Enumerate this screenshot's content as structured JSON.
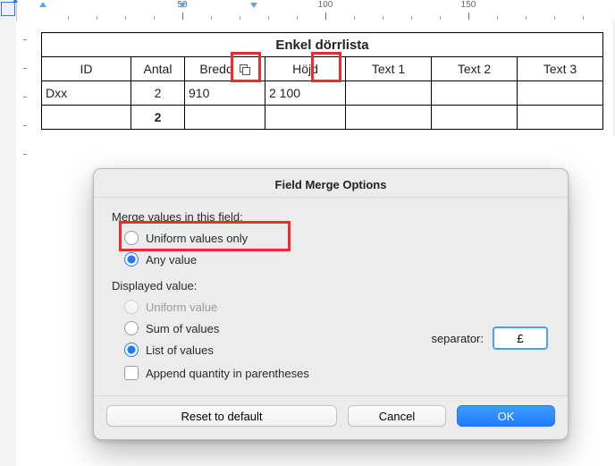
{
  "ruler": {
    "labels": [
      "50",
      "100",
      "150"
    ]
  },
  "table": {
    "title": "Enkel dörrlista",
    "headers": [
      "ID",
      "Antal",
      "Bredd",
      "Höjd",
      "Text 1",
      "Text 2",
      "Text 3"
    ],
    "merge_indicator_on": [
      2
    ],
    "rows": [
      {
        "id": "Dxx",
        "antal": "2",
        "bredd": "910",
        "hojd": "2 100",
        "t1": "",
        "t2": "",
        "t3": ""
      }
    ],
    "totals": {
      "antal": "2"
    }
  },
  "dialog": {
    "title": "Field Merge Options",
    "section_merge": "Merge values in this field:",
    "opt_uniform_only": "Uniform values only",
    "opt_any_value": "Any value",
    "merge_selected": "any",
    "section_display": "Displayed value:",
    "opt_uniform_value": "Uniform value",
    "opt_sum": "Sum of values",
    "opt_list": "List of values",
    "display_selected": "list",
    "chk_append_qty": "Append quantity in parentheses",
    "append_qty_checked": false,
    "separator_label": "separator:",
    "separator_value": "£",
    "btn_reset": "Reset to default",
    "btn_cancel": "Cancel",
    "btn_ok": "OK"
  },
  "colors": {
    "accent": "#1e7bff",
    "callout": "#ef2a2a"
  }
}
